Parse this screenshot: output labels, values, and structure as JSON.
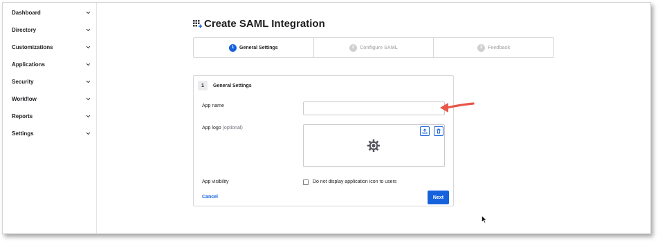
{
  "sidebar": {
    "items": [
      {
        "label": "Dashboard"
      },
      {
        "label": "Directory"
      },
      {
        "label": "Customizations"
      },
      {
        "label": "Applications"
      },
      {
        "label": "Security"
      },
      {
        "label": "Workflow"
      },
      {
        "label": "Reports"
      },
      {
        "label": "Settings"
      }
    ]
  },
  "page": {
    "title": "Create SAML Integration",
    "title_icon": "apps-add-icon"
  },
  "stepper": {
    "steps": [
      {
        "num": "1",
        "label": "General Settings",
        "active": true
      },
      {
        "num": "2",
        "label": "Configure SAML",
        "active": false
      },
      {
        "num": "3",
        "label": "Feedback",
        "active": false
      }
    ]
  },
  "form": {
    "section_num": "1",
    "section_title": "General Settings",
    "app_name_label": "App name",
    "app_name_value": "",
    "app_logo_label": "App logo",
    "app_logo_optional": "(optional)",
    "app_visibility_label": "App visibility",
    "visibility_checkbox_label": "Do not display application icon to users",
    "visibility_checked": false,
    "cancel_label": "Cancel",
    "next_label": "Next"
  },
  "colors": {
    "accent": "#1662dd",
    "annotation_arrow": "#e8574a"
  }
}
